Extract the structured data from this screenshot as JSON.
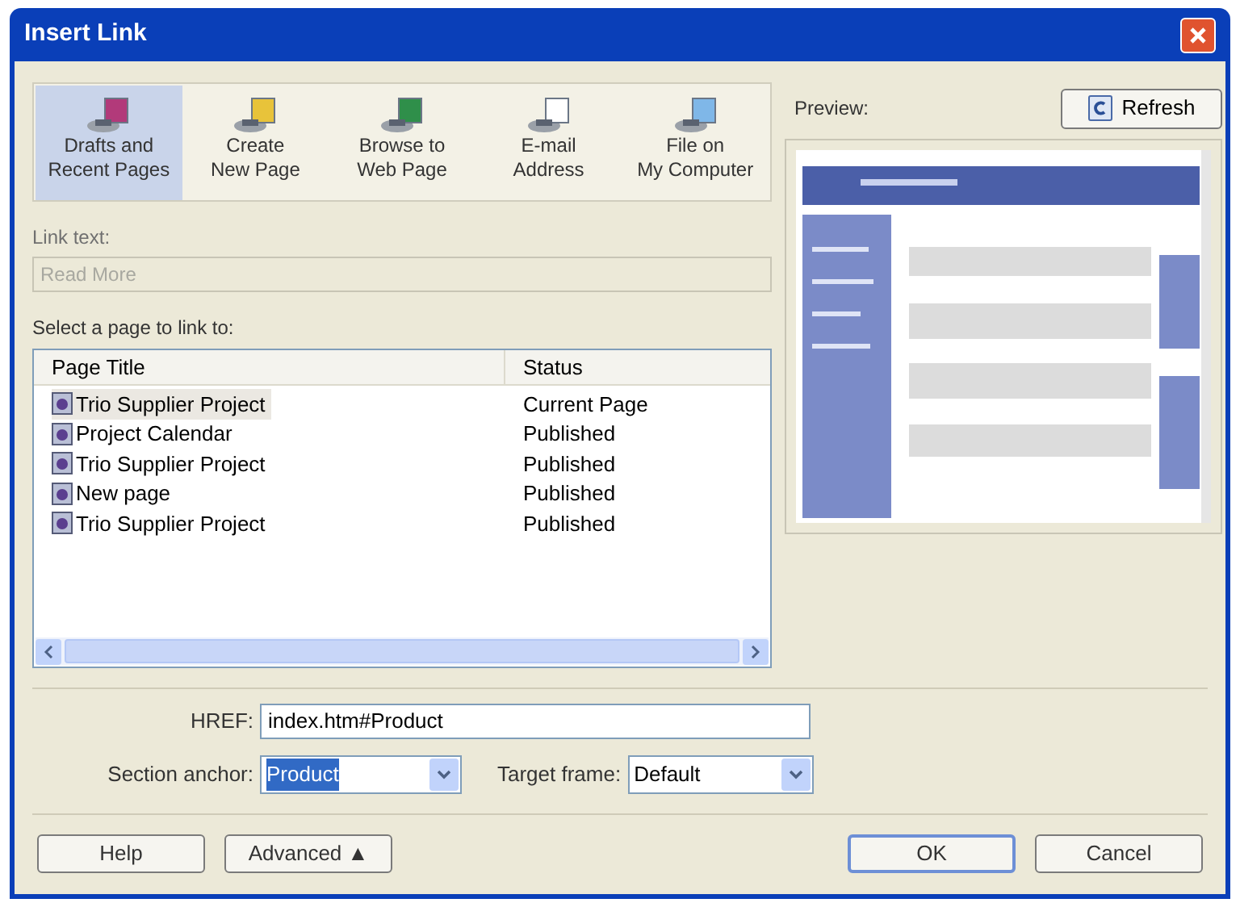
{
  "window": {
    "title": "Insert Link"
  },
  "tabs": [
    {
      "lines": [
        "Drafts and",
        "Recent Pages"
      ],
      "selected": true
    },
    {
      "lines": [
        "Create",
        "New Page"
      ],
      "selected": false
    },
    {
      "lines": [
        "Browse to",
        "Web Page"
      ],
      "selected": false
    },
    {
      "lines": [
        "E-mail",
        "Address"
      ],
      "selected": false
    },
    {
      "lines": [
        "File on",
        "My Computer"
      ],
      "selected": false
    }
  ],
  "link_text": {
    "label": "Link text:",
    "value": "Read More",
    "disabled": true
  },
  "pages": {
    "label": "Select a page to link to:",
    "columns": [
      "Page Title",
      "Status"
    ],
    "rows": [
      {
        "title": "Trio Supplier Project",
        "status": "Current Page",
        "selected": true
      },
      {
        "title": "Project Calendar",
        "status": "Published",
        "selected": false
      },
      {
        "title": "Trio Supplier Project",
        "status": "Published",
        "selected": false
      },
      {
        "title": "New page",
        "status": "Published",
        "selected": false
      },
      {
        "title": "Trio Supplier Project",
        "status": "Published",
        "selected": false
      }
    ]
  },
  "preview": {
    "label": "Preview:",
    "refresh_button": "Refresh"
  },
  "href": {
    "label": "HREF:",
    "value": "index.htm#Product"
  },
  "section_anchor": {
    "label": "Section anchor:",
    "value": "Product",
    "text_selected": true
  },
  "target_frame": {
    "label": "Target frame:",
    "value": "Default"
  },
  "buttons": [
    {
      "label": "Help",
      "default": false
    },
    {
      "label": "Advanced ▲",
      "default": false
    },
    {
      "label": "OK",
      "default": true
    },
    {
      "label": "Cancel",
      "default": false
    }
  ]
}
